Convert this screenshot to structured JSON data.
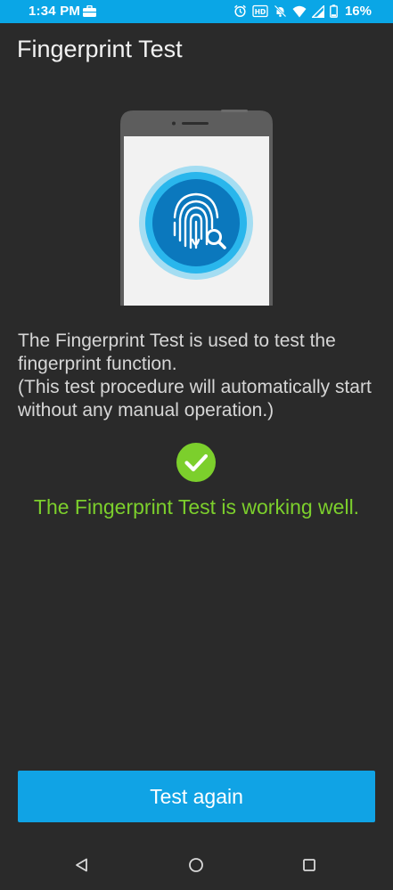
{
  "status_bar": {
    "time": "1:34 PM",
    "left_icon": "briefcase-icon",
    "right_icons": [
      "alarm-icon",
      "hd-icon",
      "do-not-disturb-icon",
      "wifi-icon",
      "signal-icon",
      "battery-icon"
    ],
    "battery": "16%",
    "background_color": "#0aa6e6"
  },
  "header": {
    "title": "Fingerprint Test"
  },
  "illustration": {
    "icon": "fingerprint-search-icon"
  },
  "description": {
    "line1": "The Fingerprint Test is used to test the fingerprint function.",
    "line2": "(This test procedure will automatically start without any manual operation.)"
  },
  "result": {
    "icon": "check-circle-icon",
    "text": "The Fingerprint Test is working well.",
    "color": "#7ccf2c"
  },
  "actions": {
    "retry_label": "Test again",
    "button_color": "#10a3e5"
  },
  "navigation": {
    "buttons": [
      "back-icon",
      "home-icon",
      "recents-icon"
    ]
  }
}
